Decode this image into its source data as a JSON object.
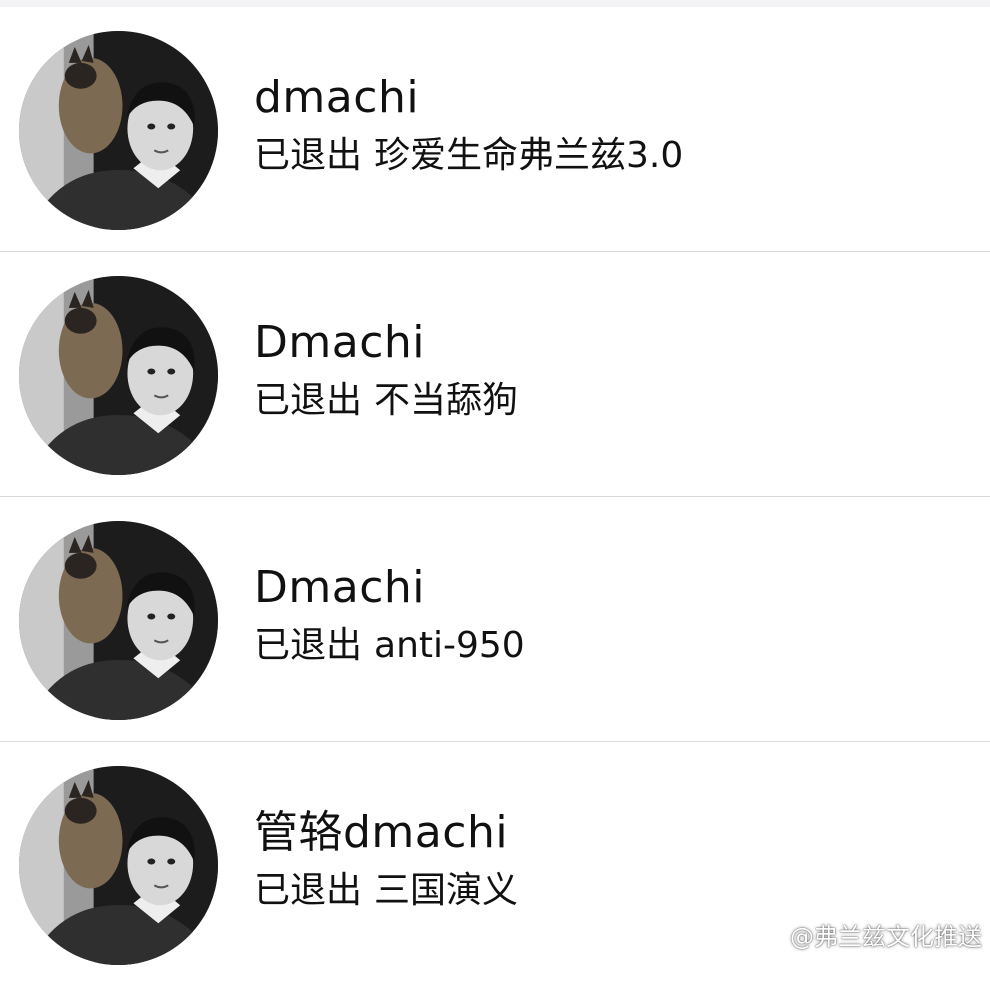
{
  "contacts": [
    {
      "name": "dmachi",
      "status": "已退出",
      "group": "珍爱生命弗兰兹3.0"
    },
    {
      "name": "Dmachi",
      "status": "已退出",
      "group": "不当舔狗"
    },
    {
      "name": "Dmachi",
      "status": "已退出",
      "group": "anti-950"
    },
    {
      "name": "管辂dmachi",
      "status": "已退出",
      "group": "三国演义"
    }
  ],
  "watermark": {
    "icon": "weibo-icon",
    "text": "@弗兰兹文化推送"
  }
}
